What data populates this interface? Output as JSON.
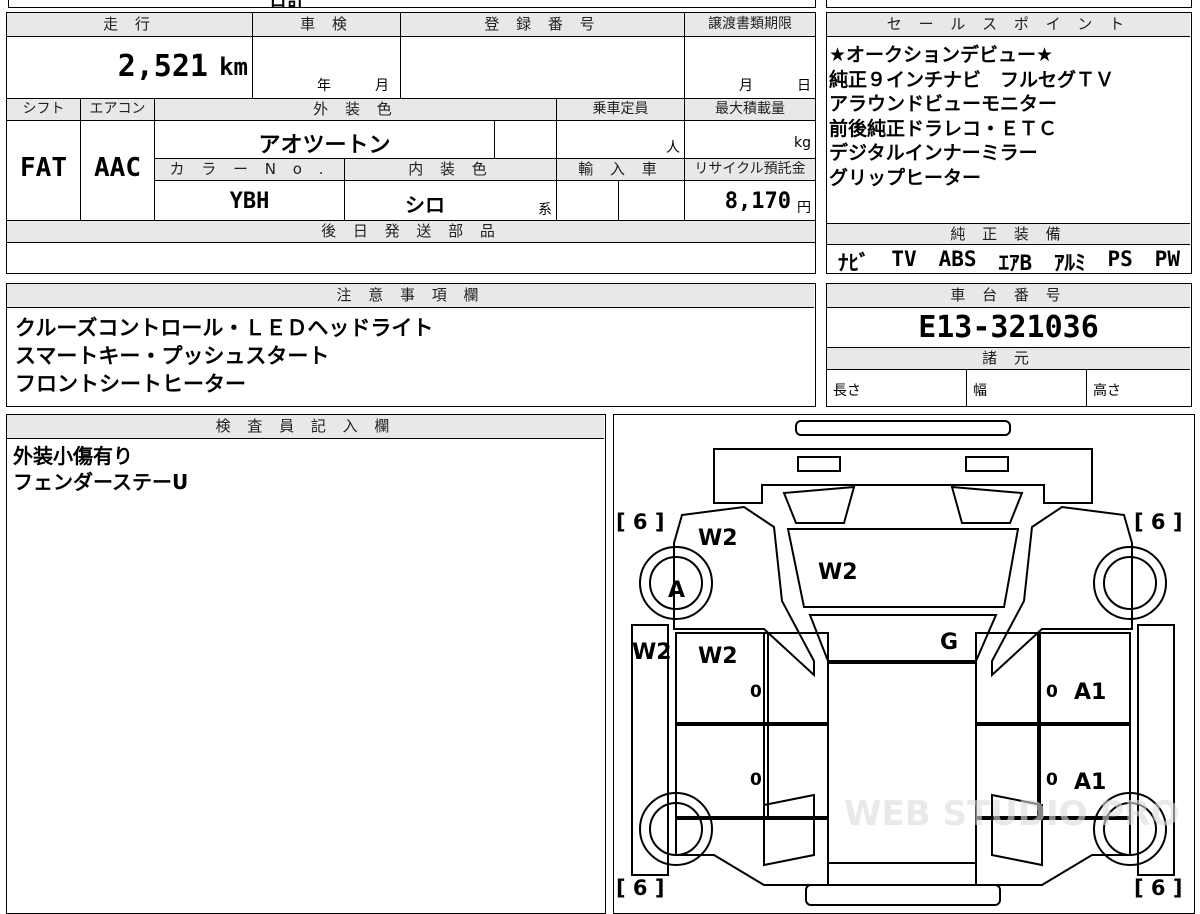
{
  "top_partial": {
    "text": "日計"
  },
  "vehicle": {
    "mileage_label": "走 行",
    "mileage": "2,521",
    "mileage_unit": "km",
    "inspection_label": "車 検",
    "inspection_year": "年",
    "inspection_month": "月",
    "registration_label": "登 録 番 号",
    "transfer_label": "譲渡書類期限",
    "transfer_month": "月",
    "transfer_day": "日",
    "shift_label": "シフト",
    "shift": "FAT",
    "aircon_label": "エアコン",
    "aircon": "AAC",
    "ext_color_label": "外 装 色",
    "ext_color": "アオツートン",
    "capacity_label": "乗車定員",
    "capacity_unit": "人",
    "maxload_label": "最大積載量",
    "maxload_unit": "kg",
    "color_no_label": "カ ラ ー N o .",
    "color_no": "YBH",
    "int_color_label": "内 装 色",
    "int_color": "シロ",
    "int_color_suffix": "系",
    "import_label": "輸 入 車",
    "recycle_label": "リサイクル預託金",
    "recycle": "8,170",
    "recycle_unit": "円",
    "later_parts_label": "後 日 発 送 部 品"
  },
  "sales_points": {
    "label": "セ ー ル ス ポ イ ン ト",
    "lines": [
      "★オークションデビュー★",
      "純正９インチナビ　フルセグＴＶ",
      "アラウンドビューモニター",
      "前後純正ドラレコ・ＥＴＣ",
      "デジタルインナーミラー",
      "グリップヒーター"
    ]
  },
  "equipment": {
    "label": "純 正 装 備",
    "items": [
      "ﾅﾋﾞ",
      "TV",
      "ABS",
      "ｴｱB",
      "ｱﾙﾐ",
      "PS",
      "PW"
    ]
  },
  "notes": {
    "label": "注 意 事 項 欄",
    "lines": [
      "クルーズコントロール・ＬＥＤヘッドライト",
      "スマートキー・プッシュスタート",
      "フロントシートヒーター"
    ]
  },
  "chassis": {
    "label": "車 台 番 号",
    "number": "E13-321036",
    "spec_label": "諸 元",
    "length_label": "長さ",
    "width_label": "幅",
    "height_label": "高さ"
  },
  "inspector": {
    "label": "検 査 員 記 入 欄",
    "lines": [
      "外装小傷有り",
      "フェンダーステーU"
    ]
  },
  "diagram": {
    "tires": [
      "[ 6 ]",
      "[ 6 ]",
      "[ 6 ]",
      "[ 6 ]"
    ],
    "marks": {
      "hood": "W2",
      "front_left_fender": "W2",
      "left_front_wheel": "A",
      "left_front_door_outer": "W2",
      "left_front_door": "W2",
      "windshield": "G",
      "right_front_door": "A1",
      "right_rear_door": "A1",
      "left_front_door_zero": "0",
      "left_rear_door_zero": "0",
      "right_front_door_zero": "0",
      "right_rear_door_zero": "0"
    },
    "watermark": "WEB STUDIO PRO"
  }
}
